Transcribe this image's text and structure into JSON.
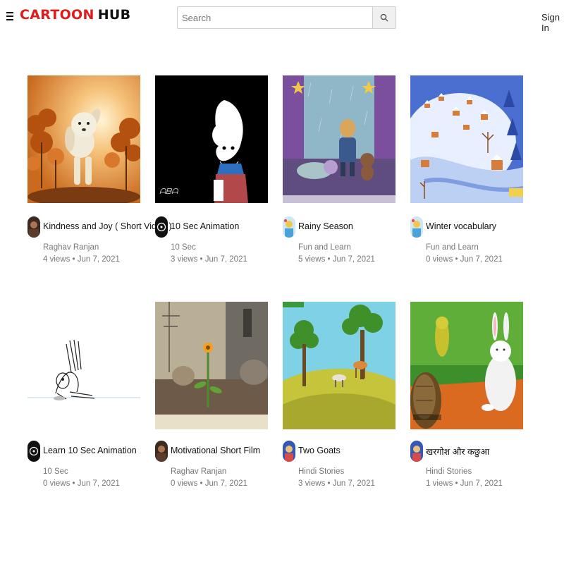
{
  "header": {
    "logo_part_a": "CARTOON",
    "logo_part_b": "HUB",
    "search_placeholder": "Search",
    "sign_in_label": "Sign In",
    "icons": [
      "menu-icon",
      "search-icon"
    ]
  },
  "colors": {
    "brand_red": "#e01b1b",
    "text_primary": "#111111",
    "text_secondary": "#777777"
  },
  "videos": [
    {
      "title": "Kindness and Joy ( Short Video )",
      "channel": "Raghav Ranjan",
      "meta": "4 views • Jun 7, 2021"
    },
    {
      "title": "10 Sec Animation",
      "channel": "10 Sec",
      "meta": "3 views • Jun 7, 2021"
    },
    {
      "title": "Rainy Season",
      "channel": "Fun and Learn",
      "meta": "5 views • Jun 7, 2021"
    },
    {
      "title": "Winter vocabulary",
      "channel": "Fun and Learn",
      "meta": "0 views • Jun 7, 2021"
    },
    {
      "title": "Learn 10 Sec Animation",
      "channel": "10 Sec",
      "meta": "0 views • Jun 7, 2021"
    },
    {
      "title": "Motivational Short Film",
      "channel": "Raghav Ranjan",
      "meta": "0 views • Jun 7, 2021"
    },
    {
      "title": "Two Goats",
      "channel": "Hindi Stories",
      "meta": "3 views • Jun 7, 2021"
    },
    {
      "title": "खरगोश और कछुआ",
      "channel": "Hindi Stories",
      "meta": "1 views • Jun 7, 2021"
    }
  ]
}
